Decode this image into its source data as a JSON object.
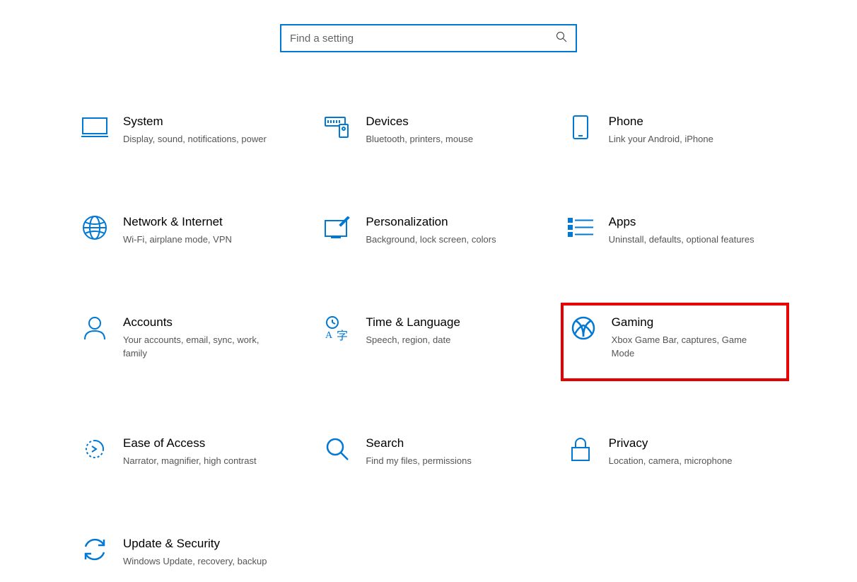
{
  "search": {
    "placeholder": "Find a setting"
  },
  "tiles": {
    "system": {
      "title": "System",
      "desc": "Display, sound, notifications, power"
    },
    "devices": {
      "title": "Devices",
      "desc": "Bluetooth, printers, mouse"
    },
    "phone": {
      "title": "Phone",
      "desc": "Link your Android, iPhone"
    },
    "network": {
      "title": "Network & Internet",
      "desc": "Wi-Fi, airplane mode, VPN"
    },
    "personalization": {
      "title": "Personalization",
      "desc": "Background, lock screen, colors"
    },
    "apps": {
      "title": "Apps",
      "desc": "Uninstall, defaults, optional features"
    },
    "accounts": {
      "title": "Accounts",
      "desc": "Your accounts, email, sync, work, family"
    },
    "time": {
      "title": "Time & Language",
      "desc": "Speech, region, date"
    },
    "gaming": {
      "title": "Gaming",
      "desc": "Xbox Game Bar, captures, Game Mode"
    },
    "ease": {
      "title": "Ease of Access",
      "desc": "Narrator, magnifier, high contrast"
    },
    "search_cat": {
      "title": "Search",
      "desc": "Find my files, permissions"
    },
    "privacy": {
      "title": "Privacy",
      "desc": "Location, camera, microphone"
    },
    "update": {
      "title": "Update & Security",
      "desc": "Windows Update, recovery, backup"
    }
  },
  "colors": {
    "accent": "#0078d4",
    "highlight": "#e60000"
  }
}
